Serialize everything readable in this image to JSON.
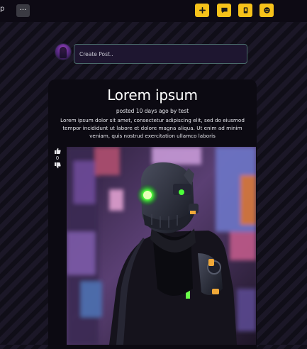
{
  "header": {
    "brand_text": "p",
    "menu_glyph": "···",
    "menu_icon": "ellipsis-icon",
    "actions": [
      {
        "name": "add-button",
        "icon": "plus-icon"
      },
      {
        "name": "messages-button",
        "icon": "chat-icon"
      },
      {
        "name": "notifications-button",
        "icon": "bell-icon"
      },
      {
        "name": "profile-button",
        "icon": "smiley-icon"
      }
    ],
    "accent_color": "#f6c21a"
  },
  "create_post": {
    "placeholder": "Create Post..",
    "avatar_icon": "user-avatar"
  },
  "post": {
    "title": "Lorem ipsum",
    "meta": "posted 10 days ago by test",
    "body": "Lorem ipsum dolor sit amet, consectetur adipiscing elit, sed do eiusmod tempor incididunt ut labore et dolore magna aliqua. Ut enim ad minim veniam, quis nostrud exercitation ullamco laboris",
    "votes": "0",
    "upvote_icon": "thumbs-up-icon",
    "downvote_icon": "thumbs-down-icon",
    "image_subject": "cyberpunk helmeted figure with glowing green eye"
  }
}
